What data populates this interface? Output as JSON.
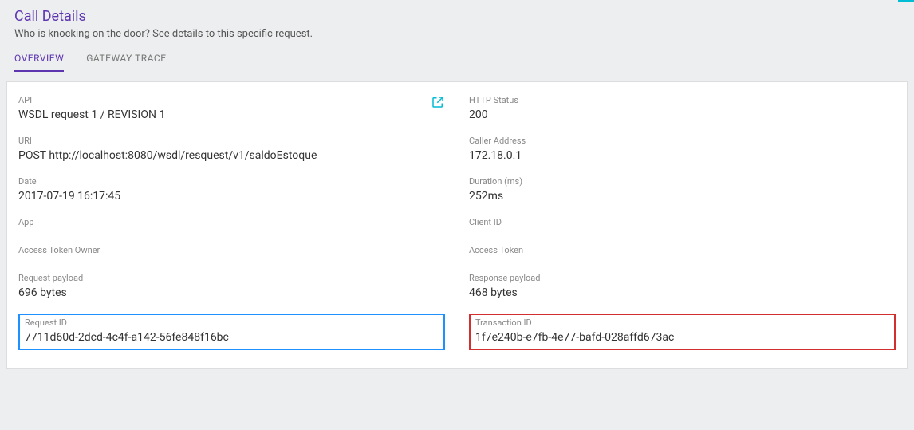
{
  "header": {
    "title": "Call Details",
    "subtitle": "Who is knocking on the door? See details to this specific request."
  },
  "tabs": {
    "overview": "OVERVIEW",
    "gateway_trace": "GATEWAY TRACE"
  },
  "fields": {
    "api": {
      "label": "API",
      "value": "WSDL request 1 / REVISION 1"
    },
    "http_status": {
      "label": "HTTP Status",
      "value": "200"
    },
    "uri": {
      "label": "URI",
      "value": "POST http://localhost:8080/wsdl/resquest/v1/saldoEstoque"
    },
    "caller_address": {
      "label": "Caller Address",
      "value": "172.18.0.1"
    },
    "date": {
      "label": "Date",
      "value": "2017-07-19 16:17:45"
    },
    "duration": {
      "label": "Duration (ms)",
      "value": "252ms"
    },
    "app": {
      "label": "App",
      "value": ""
    },
    "client_id": {
      "label": "Client ID",
      "value": ""
    },
    "access_token_owner": {
      "label": "Access Token Owner",
      "value": ""
    },
    "access_token": {
      "label": "Access Token",
      "value": ""
    },
    "request_payload": {
      "label": "Request payload",
      "value": "696  bytes"
    },
    "response_payload": {
      "label": "Response payload",
      "value": "468  bytes"
    },
    "request_id": {
      "label": "Request ID",
      "value": "7711d60d-2dcd-4c4f-a142-56fe848f16bc"
    },
    "transaction_id": {
      "label": "Transaction ID",
      "value": "1f7e240b-e7fb-4e77-bafd-028affd673ac"
    }
  }
}
